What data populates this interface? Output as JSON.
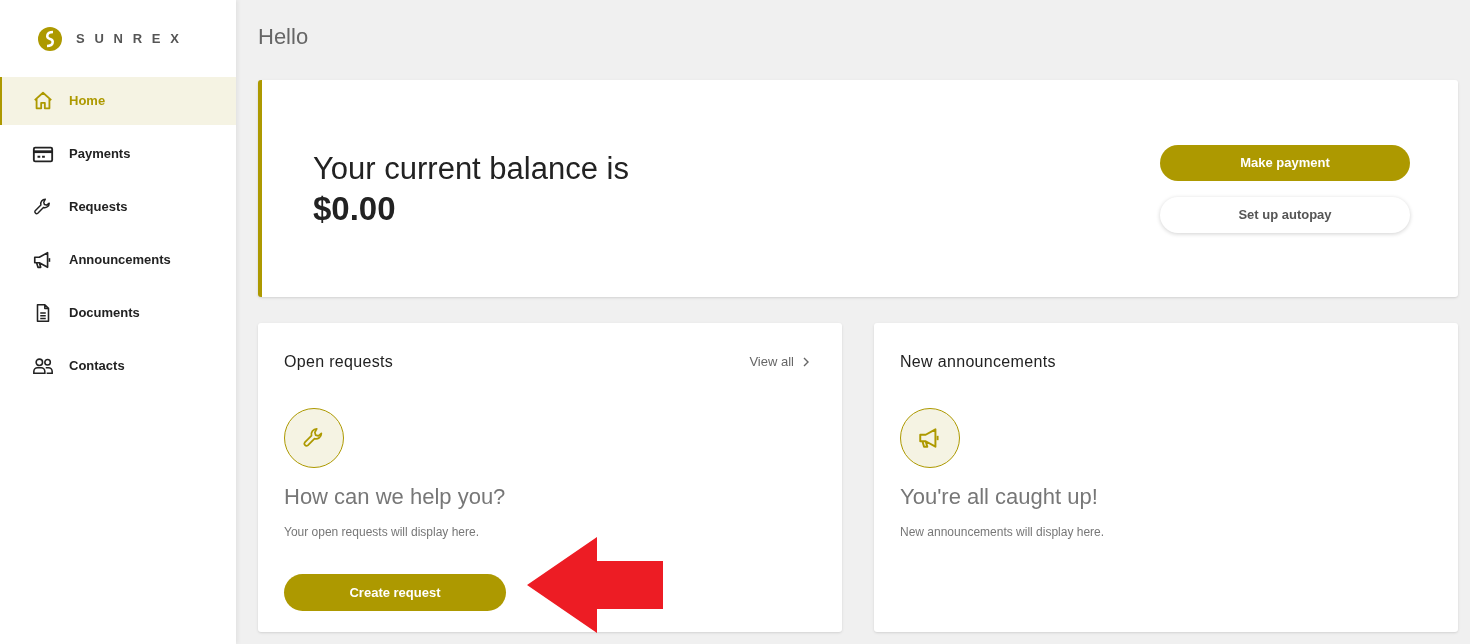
{
  "logo": {
    "text": "SUNREX"
  },
  "sidebar": {
    "items": [
      {
        "label": "Home",
        "selected": true
      },
      {
        "label": "Payments",
        "selected": false
      },
      {
        "label": "Requests",
        "selected": false
      },
      {
        "label": "Announcements",
        "selected": false
      },
      {
        "label": "Documents",
        "selected": false
      },
      {
        "label": "Contacts",
        "selected": false
      }
    ]
  },
  "greeting": "Hello",
  "balance": {
    "label": "Your current balance is",
    "amount": "$0.00",
    "buttons": [
      {
        "label": "Make payment",
        "kind": "primary"
      },
      {
        "label": "Set up autopay",
        "kind": "secondary"
      }
    ]
  },
  "cards": [
    {
      "title": "Open requests",
      "link": "View all",
      "heading": "How can we help you?",
      "text": "Your open requests will display here.",
      "button": "Create request"
    },
    {
      "title": "New announcements",
      "heading": "You're all caught up!",
      "text": "New announcements will display here."
    }
  ]
}
